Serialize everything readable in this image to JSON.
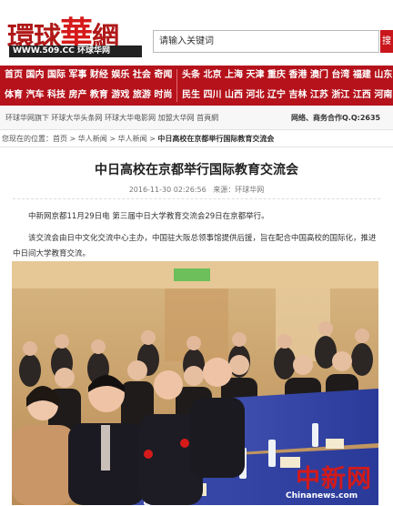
{
  "header": {
    "logo_text_1": "環球",
    "logo_text_2": "華",
    "logo_text_3": "網",
    "logo_url": "WWW.509.CC 环球华网",
    "search_placeholder": "请输入关键词",
    "search_button": "搜"
  },
  "nav": {
    "left_row1": "首页 国内 国际 军事 财经 娱乐 社会 奇闻",
    "left_row2": "体育 汽车 科技 房产 教育 游戏 旅游 时尚",
    "right_row1": "头条 北京 上海 天津 重庆 香港 澳门 台湾 福建 山东 河北",
    "right_row2": "民生 四川 山西 河北 辽宁 吉林 江苏 浙江 江西 河南 湖北"
  },
  "subbar": {
    "left": "环球华网旗下 环球大华头条网 环球大华电影网 加盟大华网 首頁網",
    "right": "网络、商务合作Q.Q:2635"
  },
  "breadcrumb": {
    "prefix": "您现在的位置：",
    "items": [
      "首页",
      "华人新闻",
      "华人新闻"
    ],
    "current": "中日高校在京都举行国际教育交流会",
    "separator": " > "
  },
  "article": {
    "title": "中日高校在京都举行国际教育交流会",
    "meta_time": "2016-11-30 02:26:56",
    "meta_source": "来源：环球华网",
    "para1": "中新网京都11月29日电 第三届中日大学教育交流会29日在京都举行。",
    "para2": "该交流会由日中文化交流中心主办，中国驻大阪总领事馆提供后援，旨在配合中国高校的国际化，推进中日间大学教育交流。"
  },
  "photo": {
    "watermark_cn": "中新网",
    "watermark_en": "Chinanews.com"
  },
  "colors": {
    "brand_red": "#b5121b",
    "logo_red": "#b01818",
    "search_red": "#c9161c",
    "crumb_bar": "#f7f7f7"
  }
}
